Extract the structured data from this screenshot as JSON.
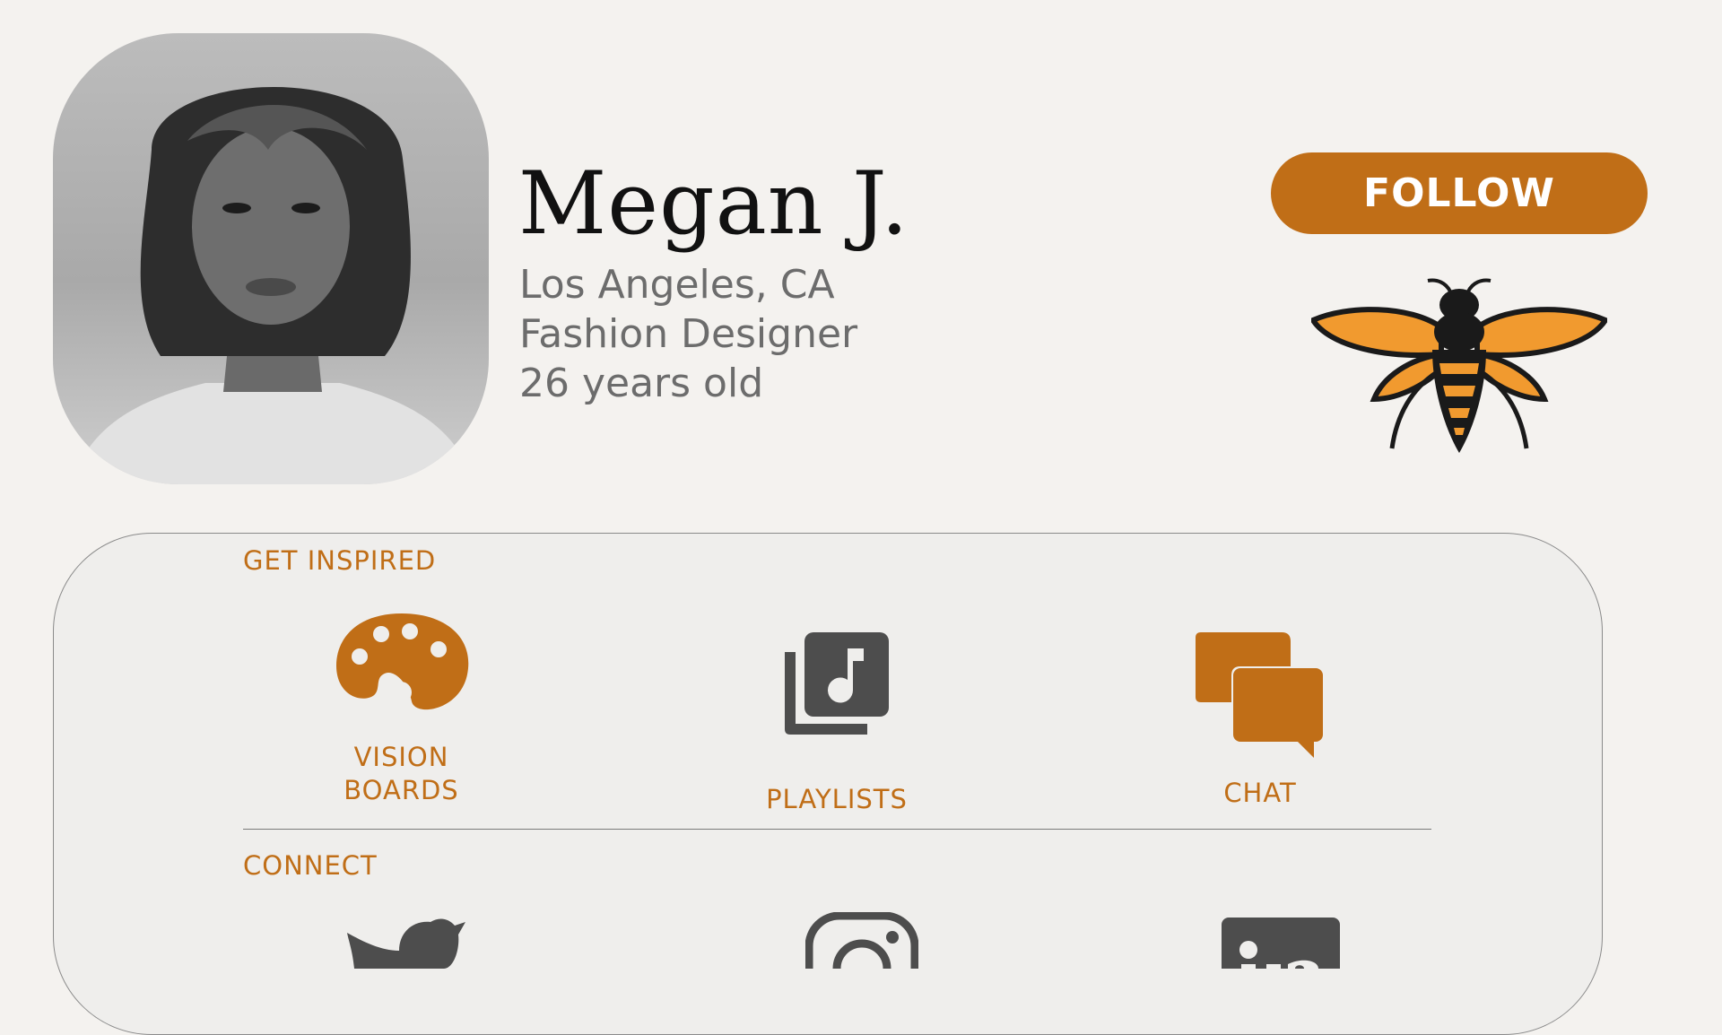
{
  "profile": {
    "name": "Megan J.",
    "location": "Los Angeles, CA",
    "occupation": "Fashion Designer",
    "age": "26 years old"
  },
  "actions": {
    "follow_label": "FOLLOW"
  },
  "inspire": {
    "section_label": "GET INSPIRED",
    "items": [
      {
        "icon": "palette-icon",
        "label_line1": "VISION",
        "label_line2": "BOARDS"
      },
      {
        "icon": "music-library-icon",
        "label": "PLAYLISTS"
      },
      {
        "icon": "chat-bubbles-icon",
        "label": "CHAT"
      }
    ]
  },
  "connect": {
    "section_label": "CONNECT",
    "items": [
      {
        "icon": "twitter-icon"
      },
      {
        "icon": "instagram-icon"
      },
      {
        "icon": "linkedin-icon"
      }
    ]
  },
  "colors": {
    "accent": "#c06e17",
    "icon_gray": "#4d4d4d",
    "background": "#f4f2ef",
    "bee_orange": "#f19a2f"
  }
}
